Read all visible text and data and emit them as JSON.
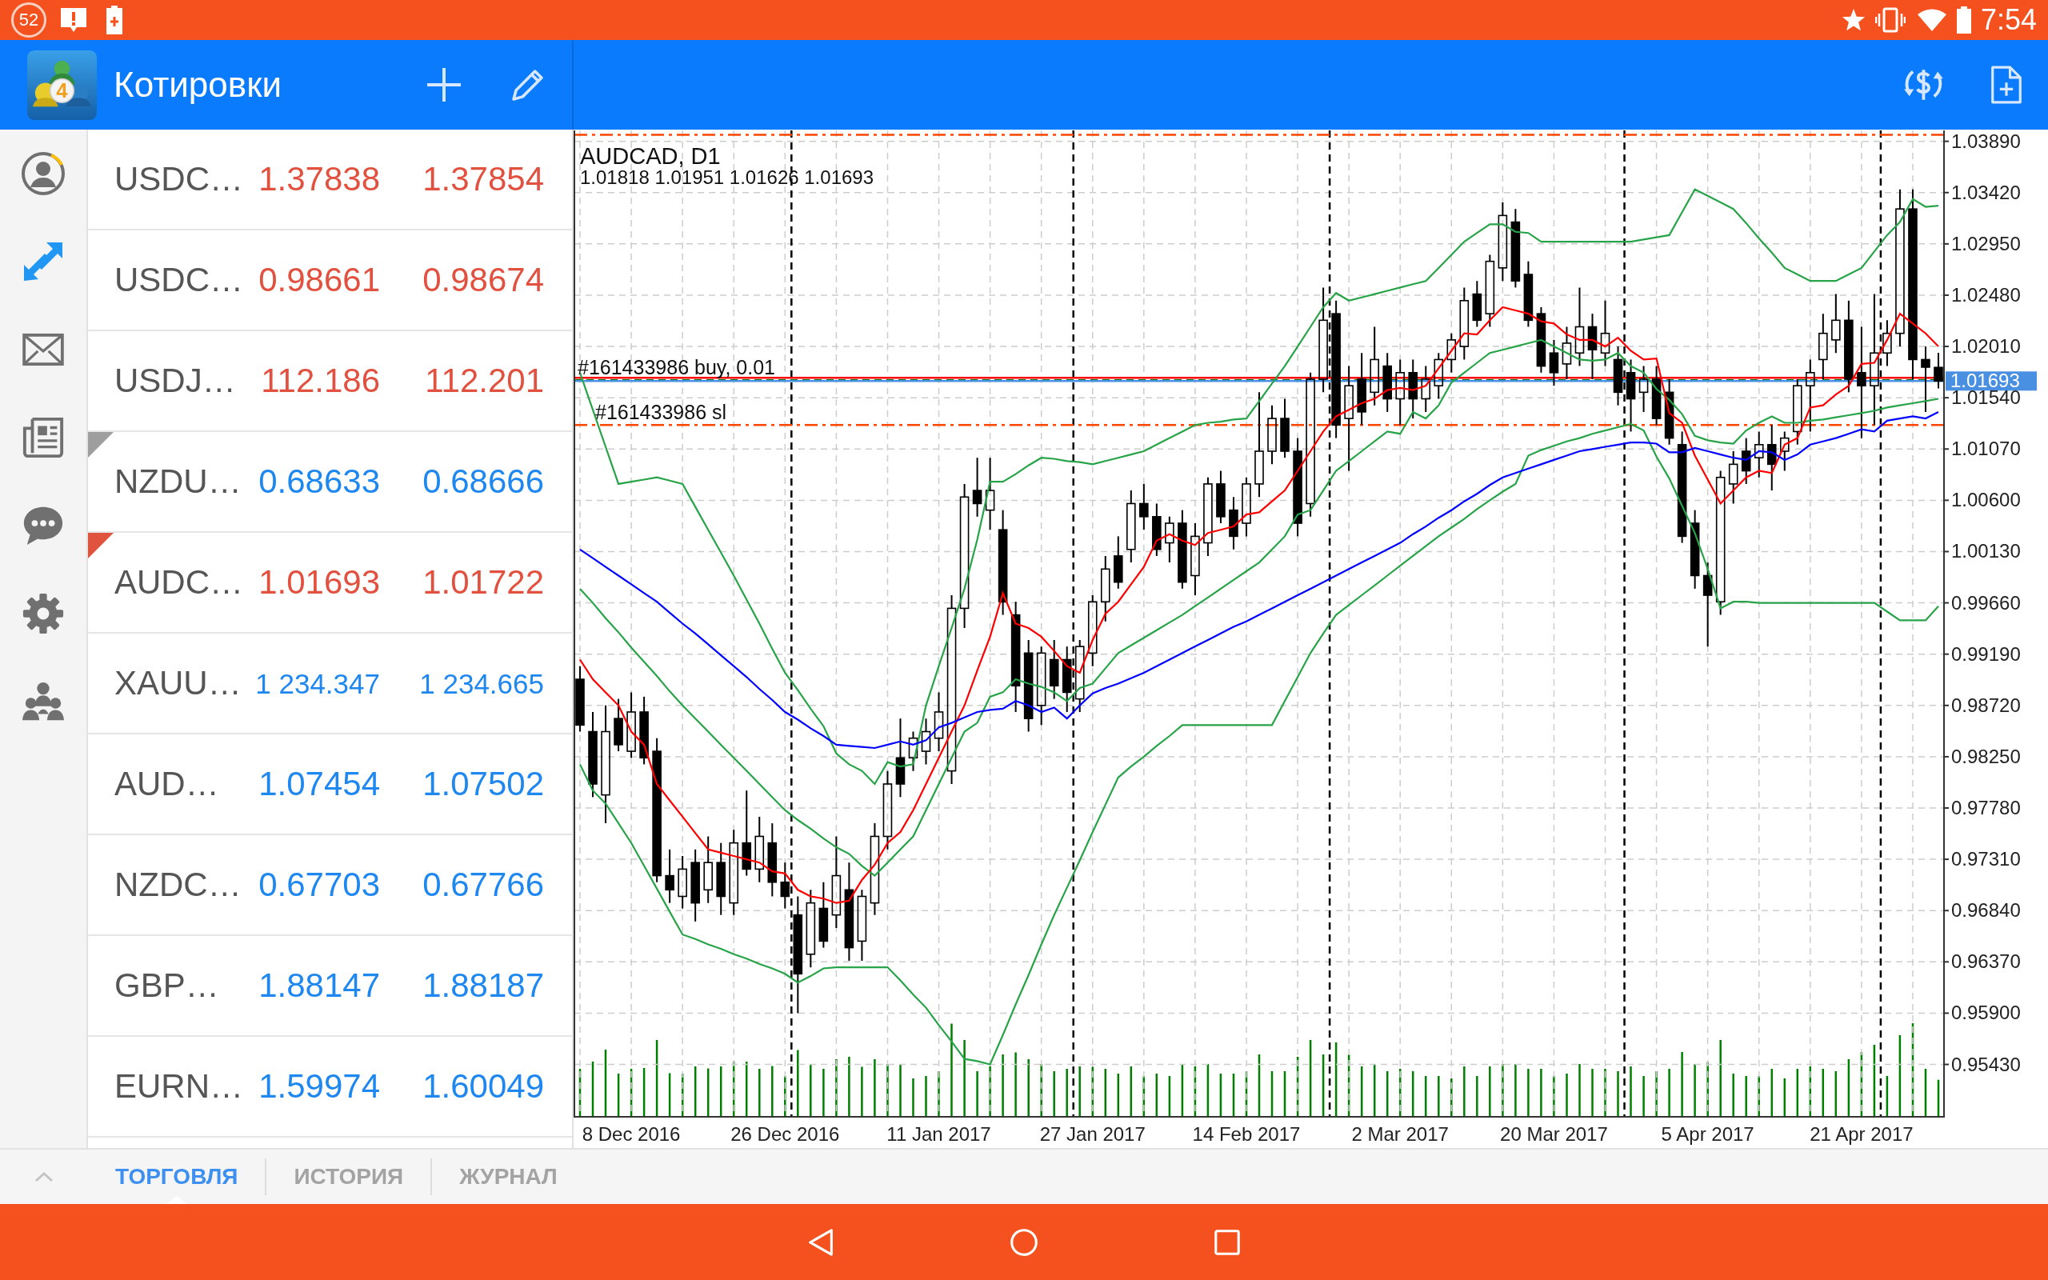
{
  "status_bar": {
    "counter": "52",
    "time": "7:54"
  },
  "header": {
    "logo_mark": "4",
    "title": "Котировки"
  },
  "sidebar": {
    "items": [
      {
        "selected": false
      },
      {
        "selected": true
      },
      {
        "selected": false
      },
      {
        "selected": false
      },
      {
        "selected": false
      },
      {
        "selected": false
      },
      {
        "selected": false
      }
    ]
  },
  "quotes": [
    {
      "symbol": "USDC…",
      "bid": "1.37838",
      "ask": "1.37854",
      "falling": true
    },
    {
      "symbol": "USDC…",
      "bid": "0.98661",
      "ask": "0.98674",
      "falling": true
    },
    {
      "symbol": "USDJ…",
      "bid": "112.186",
      "ask": "112.201",
      "falling": true
    },
    {
      "symbol": "NZDU…",
      "bid": "0.68633",
      "ask": "0.68666",
      "falling": false,
      "color": "#9e9e9e"
    },
    {
      "symbol": "AUDC…",
      "bid": "1.01693",
      "ask": "1.01722",
      "falling": true,
      "color": "#e0533f"
    },
    {
      "symbol": "XAUU…",
      "bid": "1 234.347",
      "ask": "1 234.665",
      "falling": false
    },
    {
      "symbol": "AUD…",
      "bid": "1.07454",
      "ask": "1.07502",
      "falling": false
    },
    {
      "symbol": "NZDC…",
      "bid": "0.67703",
      "ask": "0.67766",
      "falling": false
    },
    {
      "symbol": "GBP…",
      "bid": "1.88147",
      "ask": "1.88187",
      "falling": false
    },
    {
      "symbol": "EURN…",
      "bid": "1.59974",
      "ask": "1.60049",
      "falling": false
    }
  ],
  "chart": {
    "chart_data": [
      {
        "type": "candlestick",
        "title": "AUDCAD, D1",
        "subtitle": "1.01818 1.01951 1.01626 1.01693",
        "grid": true,
        "categories": [
          null,
          null,
          null,
          null,
          "8 Dec 2016",
          null,
          null,
          null,
          null,
          null,
          null,
          null,
          null,
          null,
          null,
          null,
          "26 Dec 2016",
          null,
          null,
          null,
          null,
          null,
          null,
          null,
          null,
          null,
          null,
          null,
          "11 Jan 2017",
          null,
          null,
          null,
          null,
          null,
          null,
          null,
          null,
          null,
          null,
          null,
          "27 Jan 2017",
          null,
          null,
          null,
          null,
          null,
          null,
          null,
          null,
          null,
          null,
          null,
          "14 Feb 2017",
          null,
          null,
          null,
          null,
          null,
          null,
          null,
          null,
          null,
          null,
          null,
          "2 Mar 2017",
          null,
          null,
          null,
          null,
          null,
          null,
          null,
          null,
          null,
          null,
          null,
          "20 Mar 2017",
          null,
          null,
          null,
          null,
          null,
          null,
          null,
          null,
          null,
          null,
          null,
          "5 Apr 2017",
          null,
          null,
          null,
          null,
          null,
          null,
          null,
          null,
          null,
          null,
          null,
          "21 Apr 2017",
          null,
          null,
          null,
          null,
          null,
          null
        ],
        "ohlc": [
          [
            0.9896,
            0.9908,
            0.9848,
            0.9854
          ],
          [
            0.9848,
            0.9866,
            0.9788,
            0.98
          ],
          [
            0.979,
            0.9872,
            0.9764,
            0.9848
          ],
          [
            0.986,
            0.9878,
            0.983,
            0.9836
          ],
          [
            0.983,
            0.9884,
            0.9824,
            0.9866
          ],
          [
            0.9866,
            0.988,
            0.9818,
            0.9824
          ],
          [
            0.983,
            0.9842,
            0.971,
            0.9716
          ],
          [
            0.9716,
            0.974,
            0.9691,
            0.9703
          ],
          [
            0.9697,
            0.9734,
            0.9686,
            0.9722
          ],
          [
            0.9728,
            0.974,
            0.9674,
            0.9691
          ],
          [
            0.9703,
            0.9752,
            0.9691,
            0.9728
          ],
          [
            0.9728,
            0.9746,
            0.968,
            0.9697
          ],
          [
            0.9691,
            0.9758,
            0.968,
            0.9746
          ],
          [
            0.9746,
            0.9794,
            0.9716,
            0.9722
          ],
          [
            0.9722,
            0.977,
            0.971,
            0.9752
          ],
          [
            0.9746,
            0.9764,
            0.9697,
            0.971
          ],
          [
            0.971,
            0.9728,
            0.9686,
            0.9697
          ],
          [
            0.968,
            0.9697,
            0.959,
            0.9626
          ],
          [
            0.9644,
            0.9703,
            0.9632,
            0.9691
          ],
          [
            0.9686,
            0.971,
            0.965,
            0.9656
          ],
          [
            0.968,
            0.9752,
            0.9668,
            0.9716
          ],
          [
            0.9703,
            0.9728,
            0.9638,
            0.965
          ],
          [
            0.9656,
            0.9703,
            0.9638,
            0.9697
          ],
          [
            0.9691,
            0.9764,
            0.968,
            0.9752
          ],
          [
            0.9752,
            0.9812,
            0.974,
            0.98
          ],
          [
            0.9824,
            0.986,
            0.9788,
            0.98
          ],
          [
            0.9824,
            0.9848,
            0.9812,
            0.9842
          ],
          [
            0.983,
            0.986,
            0.9818,
            0.9848
          ],
          [
            0.9842,
            0.9884,
            0.983,
            0.9866
          ],
          [
            0.9812,
            0.9973,
            0.98,
            0.9961
          ],
          [
            0.9961,
            1.0075,
            0.9943,
            1.0063
          ],
          [
            1.0069,
            1.0099,
            1.0045,
            1.0057
          ],
          [
            1.0051,
            1.0099,
            1.0033,
            1.0069
          ],
          [
            1.0033,
            1.0051,
            0.9955,
            0.9967
          ],
          [
            0.9955,
            0.9967,
            0.9866,
            0.989
          ],
          [
            0.992,
            0.9932,
            0.9848,
            0.986
          ],
          [
            0.9872,
            0.9926,
            0.9854,
            0.992
          ],
          [
            0.9914,
            0.9932,
            0.9878,
            0.989
          ],
          [
            0.9914,
            0.9926,
            0.9866,
            0.9884
          ],
          [
            0.9878,
            0.9932,
            0.9866,
            0.9926
          ],
          [
            0.992,
            0.9973,
            0.9908,
            0.9967
          ],
          [
            0.9967,
            1.0009,
            0.9949,
            0.9997
          ],
          [
            1.0009,
            1.0027,
            0.9979,
            0.9985
          ],
          [
            1.0015,
            1.0069,
            1.0003,
            1.0057
          ],
          [
            1.0057,
            1.0075,
            1.0033,
            1.0045
          ],
          [
            1.0045,
            1.0057,
            1.0009,
            1.0015
          ],
          [
            1.0021,
            1.0045,
            1.0003,
            1.0039
          ],
          [
            1.0039,
            1.0051,
            0.9979,
            0.9985
          ],
          [
            0.9991,
            1.0039,
            0.9973,
            1.0027
          ],
          [
            1.0021,
            1.0081,
            1.0009,
            1.0075
          ],
          [
            1.0075,
            1.0087,
            1.0039,
            1.0045
          ],
          [
            1.0051,
            1.0063,
            1.0015,
            1.0027
          ],
          [
            1.0039,
            1.0081,
            1.0027,
            1.0075
          ],
          [
            1.0075,
            1.0159,
            1.0063,
            1.0105
          ],
          [
            1.0105,
            1.0147,
            1.0093,
            1.0135
          ],
          [
            1.0135,
            1.0153,
            1.0099,
            1.0105
          ],
          [
            1.0105,
            1.0117,
            1.0027,
            1.0039
          ],
          [
            1.0057,
            1.0177,
            1.0045,
            1.0171
          ],
          [
            1.0171,
            1.0255,
            1.0159,
            1.0225
          ],
          [
            1.0231,
            1.0243,
            1.0117,
            1.0129
          ],
          [
            1.0135,
            1.0183,
            1.0087,
            1.0165
          ],
          [
            1.0171,
            1.0195,
            1.0129,
            1.0141
          ],
          [
            1.0159,
            1.0219,
            1.0147,
            1.0189
          ],
          [
            1.0183,
            1.0195,
            1.0141,
            1.0153
          ],
          [
            1.0153,
            1.0189,
            1.0129,
            1.0177
          ],
          [
            1.0177,
            1.0189,
            1.0135,
            1.0153
          ],
          [
            1.0153,
            1.0183,
            1.0141,
            1.0171
          ],
          [
            1.0165,
            1.0195,
            1.0153,
            1.0189
          ],
          [
            1.0189,
            1.0213,
            1.0177,
            1.0207
          ],
          [
            1.0201,
            1.0255,
            1.0189,
            1.0243
          ],
          [
            1.0249,
            1.0261,
            1.0219,
            1.0225
          ],
          [
            1.0231,
            1.0285,
            1.0219,
            1.0279
          ],
          [
            1.0273,
            1.0333,
            1.0261,
            1.0321
          ],
          [
            1.0315,
            1.0327,
            1.0255,
            1.0261
          ],
          [
            1.0267,
            1.0279,
            1.0219,
            1.0225
          ],
          [
            1.0231,
            1.0237,
            1.0177,
            1.0183
          ],
          [
            1.0195,
            1.0207,
            1.0165,
            1.0177
          ],
          [
            1.0185,
            1.0219,
            1.0171,
            1.0204
          ],
          [
            1.0195,
            1.0255,
            1.0183,
            1.0219
          ],
          [
            1.0219,
            1.0231,
            1.0171,
            1.0198
          ],
          [
            1.0195,
            1.0243,
            1.0183,
            1.0213
          ],
          [
            1.0189,
            1.0201,
            1.0147,
            1.0159
          ],
          [
            1.0177,
            1.0189,
            1.0123,
            1.0153
          ],
          [
            1.0159,
            1.0183,
            1.0141,
            1.0171
          ],
          [
            1.0171,
            1.0183,
            1.0129,
            1.0135
          ],
          [
            1.0159,
            1.0171,
            1.0111,
            1.0117
          ],
          [
            1.0111,
            1.0123,
            1.0021,
            1.0027
          ],
          [
            1.0039,
            1.0051,
            0.9979,
            0.9991
          ],
          [
            0.9991,
            1.0003,
            0.9926,
            0.9973
          ],
          [
            0.9967,
            1.0087,
            0.9955,
            1.0081
          ],
          [
            1.0075,
            1.0105,
            1.0057,
            1.0093
          ],
          [
            1.0105,
            1.0117,
            1.0075,
            1.0087
          ],
          [
            1.0099,
            1.0123,
            1.0081,
            1.0111
          ],
          [
            1.0111,
            1.0129,
            1.0069,
            1.0093
          ],
          [
            1.0105,
            1.0123,
            1.0087,
            1.0117
          ],
          [
            1.0123,
            1.0171,
            1.0111,
            1.0165
          ],
          [
            1.0165,
            1.0189,
            1.0123,
            1.0177
          ],
          [
            1.0189,
            1.0231,
            1.0171,
            1.0213
          ],
          [
            1.0207,
            1.0249,
            1.0195,
            1.0225
          ],
          [
            1.0225,
            1.0243,
            1.0159,
            1.0171
          ],
          [
            1.0177,
            1.0219,
            1.0117,
            1.0165
          ],
          [
            1.0165,
            1.0249,
            1.0129,
            1.0195
          ],
          [
            1.0195,
            1.0225,
            1.0183,
            1.0213
          ],
          [
            1.0213,
            1.0345,
            1.0201,
            1.0327
          ],
          [
            1.0327,
            1.0345,
            1.0171,
            1.0189
          ],
          [
            1.0189,
            1.0201,
            1.0141,
            1.0182
          ],
          [
            1.01818,
            1.01951,
            1.01626,
            1.01693
          ]
        ],
        "series": [
          {
            "type": "line",
            "color": "#27a348",
            "values": [
              1.0177,
              1.0143,
              1.0109,
              1.0075,
              1.0077,
              1.0079,
              1.0081,
              1.0078,
              1.0075,
              1.0054,
              1.0033,
              1.0012,
              0.9991,
              0.9969,
              0.9947,
              0.9924,
              0.9902,
              0.9886,
              0.9869,
              0.9853,
              0.9828,
              0.9818,
              0.9812,
              0.98,
              0.982,
              0.9816,
              0.9818,
              0.9872,
              0.9908,
              0.9943,
              0.9979,
              1.0024,
              1.0077,
              1.0077,
              1.0084,
              1.0092,
              1.0099,
              1.0098,
              1.0096,
              1.0095,
              1.0093,
              1.0096,
              1.0099,
              1.0102,
              1.0105,
              1.0111,
              1.0117,
              1.0123,
              1.0129,
              1.0131,
              1.0132,
              1.0134,
              1.0135,
              1.0151,
              1.0167,
              1.0183,
              1.0201,
              1.0219,
              1.0237,
              1.025,
              1.0243,
              1.0246,
              1.0249,
              1.0252,
              1.0255,
              1.0258,
              1.0261,
              1.0273,
              1.0285,
              1.0297,
              1.0305,
              1.0313,
              1.0313,
              1.0306,
              1.0305,
              1.0297,
              1.0297,
              1.0297,
              1.0297,
              1.0297,
              1.0297,
              1.0297,
              1.0297,
              1.0299,
              1.0301,
              1.0303,
              1.0324,
              1.0345,
              1.0339,
              1.0333,
              1.0327,
              1.0314,
              1.03,
              1.0287,
              1.0273,
              1.0267,
              1.0261,
              1.0261,
              1.0261,
              1.0267,
              1.0273,
              1.0288,
              1.0303,
              1.0315,
              1.0336,
              1.0329,
              1.033
            ]
          },
          {
            "type": "line",
            "color": "#27a348",
            "values": [
              0.9979,
              0.9966,
              0.9952,
              0.9939,
              0.9925,
              0.9912,
              0.9899,
              0.9885,
              0.9872,
              0.986,
              0.9848,
              0.9836,
              0.9824,
              0.9812,
              0.98,
              0.9788,
              0.9776,
              0.9767,
              0.9759,
              0.975,
              0.9742,
              0.9736,
              0.9725,
              0.9716,
              0.9728,
              0.974,
              0.9752,
              0.9776,
              0.98,
              0.9824,
              0.9848,
              0.9856,
              0.988,
              0.9884,
              0.9896,
              0.9892,
              0.9889,
              0.9884,
              0.9876,
              0.9888,
              0.9892,
              0.9906,
              0.992,
              0.9927,
              0.9934,
              0.9941,
              0.9948,
              0.9955,
              0.9963,
              0.9971,
              0.9979,
              0.9987,
              0.9995,
              1.0003,
              1.0015,
              1.0027,
              1.0047,
              1.0051,
              1.0069,
              1.0087,
              1.0096,
              1.0105,
              1.0114,
              1.0123,
              1.0121,
              1.0141,
              1.0135,
              1.0147,
              1.0168,
              1.0177,
              1.0186,
              1.0195,
              1.0198,
              1.0201,
              1.0204,
              1.0207,
              1.0201,
              1.0195,
              1.0189,
              1.0188,
              1.0189,
              1.0195,
              1.0183,
              1.0177,
              1.0162,
              1.0152,
              1.0139,
              1.0119,
              1.0115,
              1.0113,
              1.0112,
              1.0124,
              1.0131,
              1.0137,
              1.0131,
              1.0131,
              1.0133,
              1.0134,
              1.0136,
              1.0138,
              1.014,
              1.0142,
              1.0145,
              1.0147,
              1.0149,
              1.0151,
              1.0153
            ]
          },
          {
            "type": "line",
            "color": "#27a348",
            "values": [
              0.9818,
              0.9794,
              0.9782,
              0.9764,
              0.9746,
              0.9725,
              0.9704,
              0.9683,
              0.9662,
              0.9658,
              0.9653,
              0.9649,
              0.9644,
              0.964,
              0.9635,
              0.9631,
              0.9626,
              0.9618,
              0.9624,
              0.9631,
              0.9632,
              0.9632,
              0.9632,
              0.9632,
              0.9632,
              0.962,
              0.9607,
              0.9595,
              0.9579,
              0.9564,
              0.9548,
              0.9546,
              0.9543,
              0.957,
              0.9598,
              0.9625,
              0.9653,
              0.968,
              0.9705,
              0.973,
              0.9756,
              0.9781,
              0.9806,
              0.9816,
              0.9825,
              0.9835,
              0.9844,
              0.9854,
              0.9854,
              0.9854,
              0.9854,
              0.9854,
              0.9854,
              0.9854,
              0.9854,
              0.9876,
              0.9898,
              0.992,
              0.9938,
              0.9955,
              0.9964,
              0.9973,
              0.9982,
              0.9991,
              1.0,
              1.0009,
              1.0018,
              1.0027,
              1.0035,
              1.0043,
              1.0052,
              1.006,
              1.0068,
              1.0075,
              1.0101,
              1.0106,
              1.011,
              1.0114,
              1.0117,
              1.0121,
              1.0124,
              1.0127,
              1.013,
              1.0124,
              1.01,
              1.008,
              1.0055,
              1.003,
              0.9997,
              0.9961,
              0.9967,
              0.9967,
              0.9966,
              0.9966,
              0.9966,
              0.9966,
              0.9966,
              0.9966,
              0.9966,
              0.9966,
              0.9966,
              0.9966,
              0.9958,
              0.995,
              0.995,
              0.995,
              0.9963
            ]
          },
          {
            "type": "line",
            "color": "#ff0000",
            "values": [
              0.9914,
              0.9896,
              0.9884,
              0.9872,
              0.9848,
              0.9836,
              0.98,
              0.9785,
              0.977,
              0.9755,
              0.974,
              0.9737,
              0.9734,
              0.9731,
              0.9728,
              0.972,
              0.9718,
              0.9703,
              0.9697,
              0.9695,
              0.9691,
              0.9693,
              0.9712,
              0.9726,
              0.9746,
              0.9756,
              0.9776,
              0.98,
              0.9824,
              0.9848,
              0.9872,
              0.9904,
              0.9935,
              0.9975,
              0.9947,
              0.9943,
              0.9935,
              0.9922,
              0.9908,
              0.9902,
              0.9932,
              0.9956,
              0.9967,
              0.9983,
              0.9999,
              1.0023,
              1.0029,
              1.0023,
              1.0019,
              1.003,
              1.0033,
              1.0036,
              1.0047,
              1.0049,
              1.0059,
              1.0069,
              1.0087,
              1.0105,
              1.0123,
              1.0137,
              1.0143,
              1.0149,
              1.0153,
              1.0161,
              1.0163,
              1.0161,
              1.0165,
              1.0181,
              1.0197,
              1.0213,
              1.0212,
              1.0225,
              1.0237,
              1.0234,
              1.0231,
              1.0224,
              1.0222,
              1.0212,
              1.0207,
              1.0207,
              1.0201,
              1.0209,
              1.0197,
              1.0189,
              1.019,
              1.014,
              1.0131,
              1.0101,
              1.0079,
              1.0057,
              1.0069,
              1.0081,
              1.0087,
              1.0085,
              1.0111,
              1.0117,
              1.0145,
              1.0147,
              1.0157,
              1.0165,
              1.0185,
              1.0186,
              1.0207,
              1.0231,
              1.0222,
              1.0213,
              1.0201
            ]
          },
          {
            "type": "line",
            "color": "#0000ff",
            "values": [
              1.0015,
              1.0007,
              0.9999,
              0.9991,
              0.9983,
              0.9975,
              0.9967,
              0.9957,
              0.9947,
              0.9938,
              0.9928,
              0.9918,
              0.9908,
              0.9898,
              0.9887,
              0.9877,
              0.9866,
              0.9859,
              0.9851,
              0.9844,
              0.9836,
              0.9835,
              0.9834,
              0.9833,
              0.9836,
              0.9839,
              0.9836,
              0.984,
              0.9852,
              0.9856,
              0.9861,
              0.9866,
              0.9868,
              0.9869,
              0.9876,
              0.9872,
              0.9866,
              0.987,
              0.986,
              0.9872,
              0.9883,
              0.9888,
              0.9892,
              0.9897,
              0.9902,
              0.9908,
              0.9914,
              0.992,
              0.9926,
              0.9932,
              0.9938,
              0.9944,
              0.9949,
              0.9955,
              0.9961,
              0.9967,
              0.9973,
              0.9979,
              0.9985,
              0.9991,
              0.9997,
              1.0003,
              1.0009,
              1.0015,
              1.0021,
              1.0029,
              1.0036,
              1.0044,
              1.0051,
              1.0059,
              1.0066,
              1.0074,
              1.0081,
              1.0085,
              1.0089,
              1.0093,
              1.0097,
              1.0101,
              1.0105,
              1.0107,
              1.0109,
              1.0111,
              1.0113,
              1.0113,
              1.0112,
              1.0104,
              1.0104,
              1.0108,
              1.0105,
              1.0102,
              1.0099,
              1.0097,
              1.0105,
              1.0104,
              1.0097,
              1.0102,
              1.0111,
              1.0114,
              1.0117,
              1.0121,
              1.0125,
              1.0123,
              1.0133,
              1.0135,
              1.0137,
              1.0135,
              1.0141
            ]
          }
        ],
        "ylim": [
          0.9495,
          1.0399
        ],
        "yticks": [
          {
            "value": 1.0389,
            "label": "1.03890"
          },
          {
            "value": 1.0342,
            "label": "1.03420"
          },
          {
            "value": 1.0295,
            "label": "1.02950"
          },
          {
            "value": 1.0248,
            "label": "1.02480"
          },
          {
            "value": 1.0201,
            "label": "1.02010"
          },
          {
            "value": 1.0154,
            "label": "1.01540"
          },
          {
            "value": 1.0107,
            "label": "1.01070"
          },
          {
            "value": 1.006,
            "label": "1.00600"
          },
          {
            "value": 1.0013,
            "label": "1.00130"
          },
          {
            "value": 0.9966,
            "label": "0.99660"
          },
          {
            "value": 0.9919,
            "label": "0.99190"
          },
          {
            "value": 0.9872,
            "label": "0.98720"
          },
          {
            "value": 0.9825,
            "label": "0.98250"
          },
          {
            "value": 0.9778,
            "label": "0.97780"
          },
          {
            "value": 0.9731,
            "label": "0.97310"
          },
          {
            "value": 0.9684,
            "label": "0.96840"
          },
          {
            "value": 0.9637,
            "label": "0.96370"
          },
          {
            "value": 0.959,
            "label": "0.95900"
          },
          {
            "value": 0.9543,
            "label": "0.95430"
          }
        ],
        "ref_lines": [
          {
            "axis": "y",
            "value": 1.0395,
            "color": "#ff4500",
            "line_style": "dashdot"
          },
          {
            "axis": "y",
            "value": 1.01722,
            "color": "#ff0000",
            "line_style": "solid"
          },
          {
            "axis": "y",
            "value": 1.017,
            "label": "#161433986 buy, 0.01",
            "color": "#008000",
            "line_style": "dashed"
          },
          {
            "axis": "y",
            "value": 1.01693,
            "label": "1.01693",
            "color": "#4a90e2",
            "line_style": "solid"
          },
          {
            "axis": "y",
            "value": 1.0129,
            "label": "#161433986 sl",
            "color": "#ff4500",
            "line_style": "dashdot"
          }
        ]
      }
    ]
  },
  "tabs": [
    {
      "label": "ТОРГОВЛЯ",
      "selected": true
    },
    {
      "label": "ИСТОРИЯ",
      "selected": false
    },
    {
      "label": "ЖУРНАЛ",
      "selected": false
    }
  ]
}
